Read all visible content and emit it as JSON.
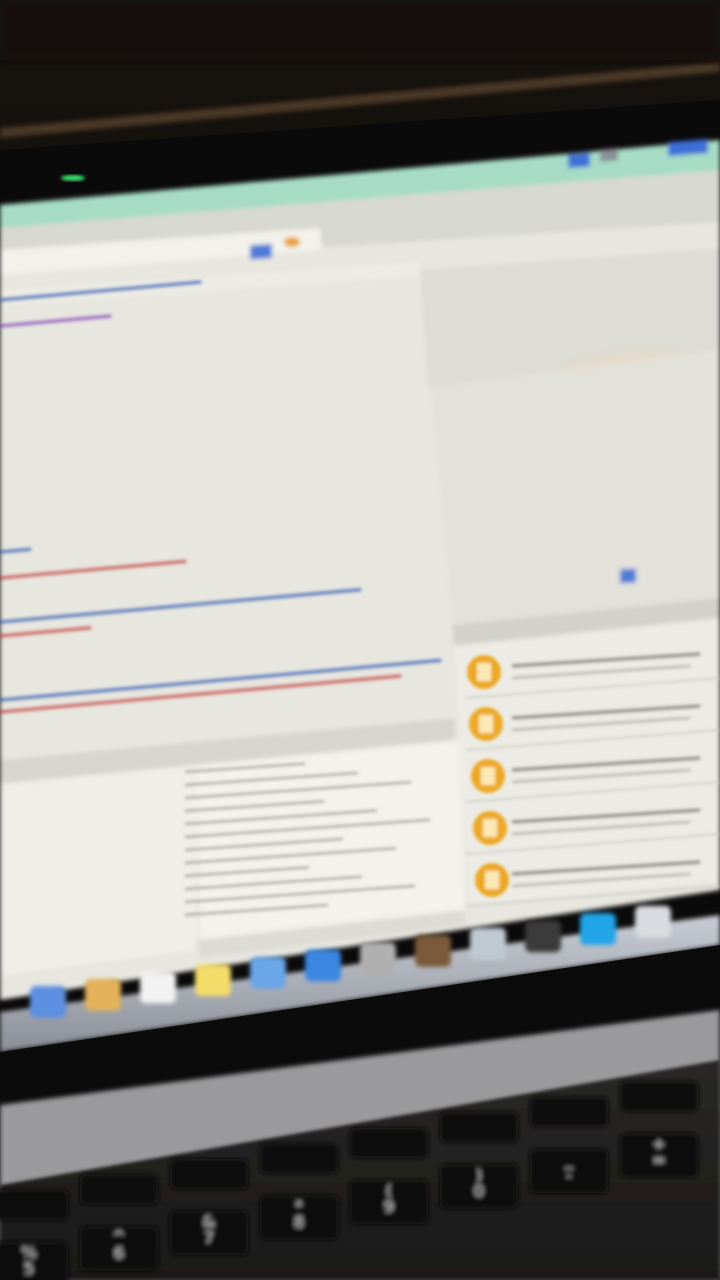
{
  "scene": {
    "description_colors": {
      "room": "#1a1510",
      "bezel": "#0a0a0a",
      "titlebar": "#a8dcc8",
      "editor_bg": "#eeede6",
      "panel_bg": "#e6e6df",
      "accent_orange": "#e8a020",
      "dock": "#b8bcc4",
      "keyboard": "#151515"
    }
  },
  "screen": {
    "status_led": "green",
    "editor": {
      "code_lines": [
        {
          "color": "#7a3bb8"
        },
        {
          "color": "#2a4fb0"
        },
        {
          "color": "#c03030"
        },
        {
          "color": "#2a4fb0"
        },
        {
          "color": "#c03030"
        },
        {
          "color": "#2a4fb0"
        },
        {
          "color": "#c03030"
        },
        {
          "color": "#2a4fb0"
        }
      ]
    },
    "library_items": [
      {
        "icon": "object-icon"
      },
      {
        "icon": "checkmark-icon"
      },
      {
        "icon": "object-icon"
      },
      {
        "icon": "sync-icon"
      },
      {
        "icon": "object-icon"
      }
    ],
    "dock_icons": [
      "finder-icon",
      "notes-icon",
      "calendar-icon",
      "stickies-icon",
      "mail-icon",
      "safari-icon",
      "photos-icon",
      "itunes-icon",
      "preview-icon",
      "terminal-icon",
      "skype-icon",
      "trash-icon"
    ]
  },
  "keyboard": {
    "function_row": [
      "",
      "",
      "",
      "",
      "",
      "",
      ""
    ],
    "number_row": [
      "%\n5",
      "^\n6",
      "&\n7",
      "*\n8",
      "(\n9",
      ")\n0",
      "_\n-",
      "+\n="
    ]
  }
}
